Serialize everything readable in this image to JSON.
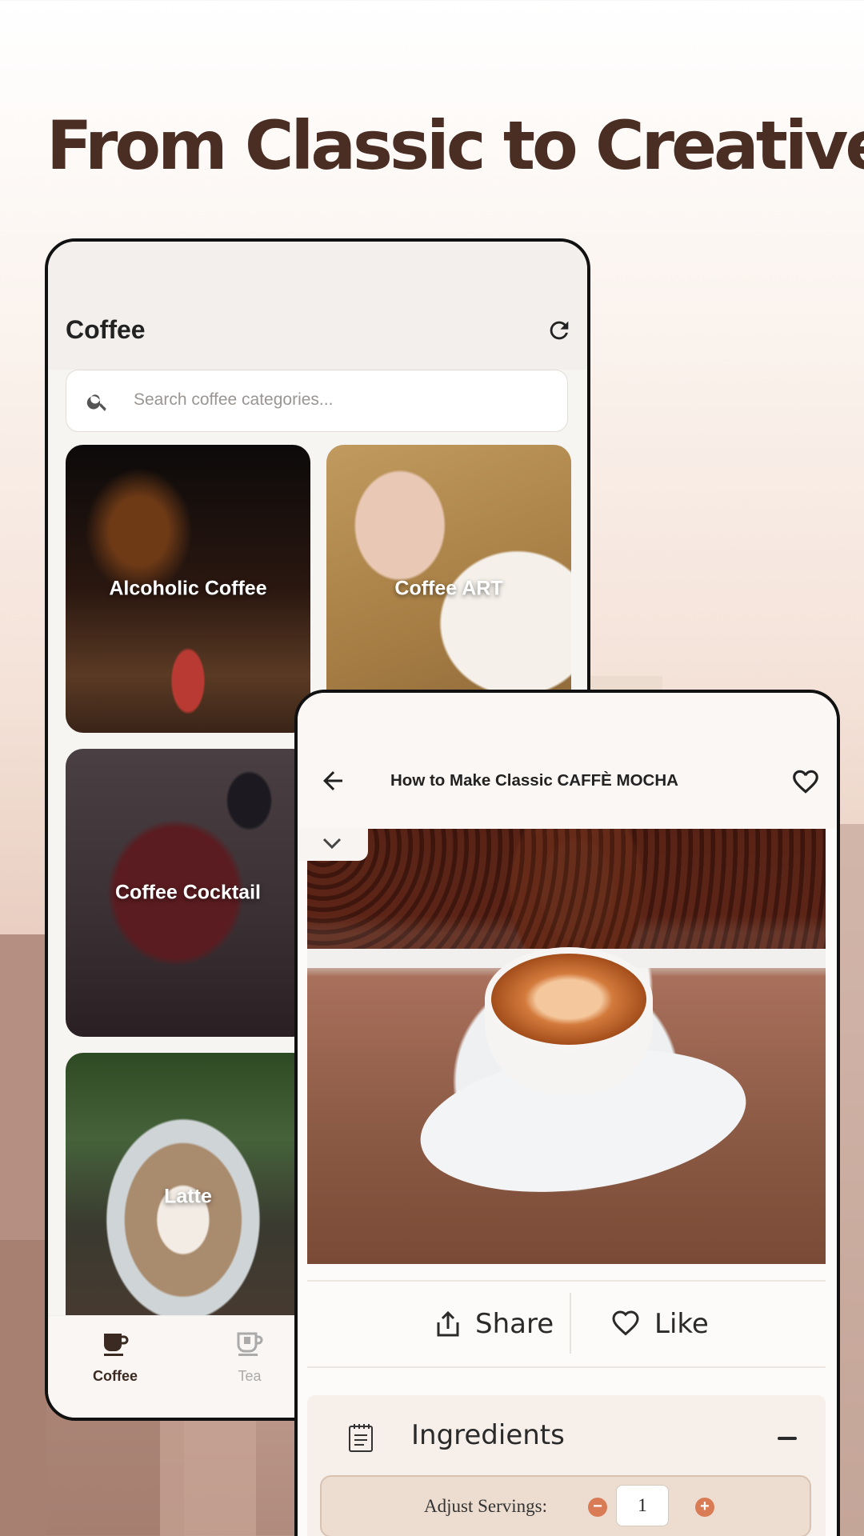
{
  "headline": "From Classic to Creative",
  "coffee_screen": {
    "title": "Coffee",
    "search": {
      "placeholder": "Search coffee categories..."
    },
    "categories": [
      {
        "label": "Alcoholic Coffee"
      },
      {
        "label": "Coffee ART"
      },
      {
        "label": "Coffee Cocktail"
      },
      {
        "label": "Latte"
      }
    ],
    "bottom_nav": [
      {
        "label": "Coffee",
        "icon": "coffee-cup-icon",
        "active": true
      },
      {
        "label": "Tea",
        "icon": "tea-icon",
        "active": false
      }
    ]
  },
  "recipe_screen": {
    "title": "How to Make Classic CAFFÈ MOCHA",
    "actions": {
      "share": "Share",
      "like": "Like"
    },
    "ingredients": {
      "title": "Ingredients",
      "servings_label": "Adjust Servings:",
      "servings_value": "1"
    }
  },
  "colors": {
    "headline": "#4a2e24",
    "accent": "#d97b54",
    "nav_active": "#3b2a22"
  }
}
